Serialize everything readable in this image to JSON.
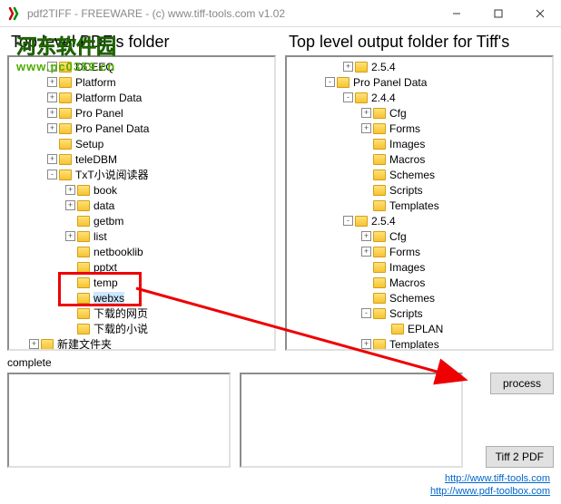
{
  "window": {
    "title": "pdf2TIFF - FREEWARE - (c) www.tiff-tools.com v1.02"
  },
  "watermark": {
    "line1": "河东软件园",
    "line2": "www.pc0359.cn"
  },
  "headers": {
    "left": "Top level PDF's folder",
    "right": "Top level output folder for Tiff's"
  },
  "leftTree": [
    {
      "d": 2,
      "e": "+",
      "t": "DCEEQ"
    },
    {
      "d": 2,
      "e": "+",
      "t": "Platform"
    },
    {
      "d": 2,
      "e": "+",
      "t": "Platform Data"
    },
    {
      "d": 2,
      "e": "+",
      "t": "Pro Panel"
    },
    {
      "d": 2,
      "e": "+",
      "t": "Pro Panel Data"
    },
    {
      "d": 2,
      "e": "",
      "t": "Setup"
    },
    {
      "d": 2,
      "e": "+",
      "t": "teleDBM"
    },
    {
      "d": 2,
      "e": "-",
      "t": "TxT小说阅读器"
    },
    {
      "d": 3,
      "e": "+",
      "t": "book"
    },
    {
      "d": 3,
      "e": "+",
      "t": "data"
    },
    {
      "d": 3,
      "e": "",
      "t": "getbm"
    },
    {
      "d": 3,
      "e": "+",
      "t": "list"
    },
    {
      "d": 3,
      "e": "",
      "t": "netbooklib"
    },
    {
      "d": 3,
      "e": "",
      "t": "pptxt"
    },
    {
      "d": 3,
      "e": "",
      "t": "temp"
    },
    {
      "d": 3,
      "e": "",
      "t": "webxs",
      "sel": true
    },
    {
      "d": 3,
      "e": "",
      "t": "下载的网页"
    },
    {
      "d": 3,
      "e": "",
      "t": "下载的小说"
    },
    {
      "d": 1,
      "e": "+",
      "t": "新建文件夹"
    }
  ],
  "rightTree": [
    {
      "d": 3,
      "e": "+",
      "t": "2.5.4"
    },
    {
      "d": 2,
      "e": "-",
      "t": "Pro Panel Data"
    },
    {
      "d": 3,
      "e": "-",
      "t": "2.4.4"
    },
    {
      "d": 4,
      "e": "+",
      "t": "Cfg"
    },
    {
      "d": 4,
      "e": "+",
      "t": "Forms"
    },
    {
      "d": 4,
      "e": "",
      "t": "Images"
    },
    {
      "d": 4,
      "e": "",
      "t": "Macros"
    },
    {
      "d": 4,
      "e": "",
      "t": "Schemes"
    },
    {
      "d": 4,
      "e": "",
      "t": "Scripts"
    },
    {
      "d": 4,
      "e": "",
      "t": "Templates"
    },
    {
      "d": 3,
      "e": "-",
      "t": "2.5.4"
    },
    {
      "d": 4,
      "e": "+",
      "t": "Cfg"
    },
    {
      "d": 4,
      "e": "+",
      "t": "Forms"
    },
    {
      "d": 4,
      "e": "",
      "t": "Images"
    },
    {
      "d": 4,
      "e": "",
      "t": "Macros"
    },
    {
      "d": 4,
      "e": "",
      "t": "Schemes"
    },
    {
      "d": 4,
      "e": "-",
      "t": "Scripts"
    },
    {
      "d": 5,
      "e": "",
      "t": "EPLAN"
    },
    {
      "d": 4,
      "e": "+",
      "t": "Templates"
    }
  ],
  "status": {
    "label": "complete"
  },
  "buttons": {
    "process": "process",
    "tiff2pdf": "Tiff 2 PDF"
  },
  "links": {
    "l1": "http://www.tiff-tools.com",
    "l2": "http://www.pdf-toolbox.com"
  }
}
